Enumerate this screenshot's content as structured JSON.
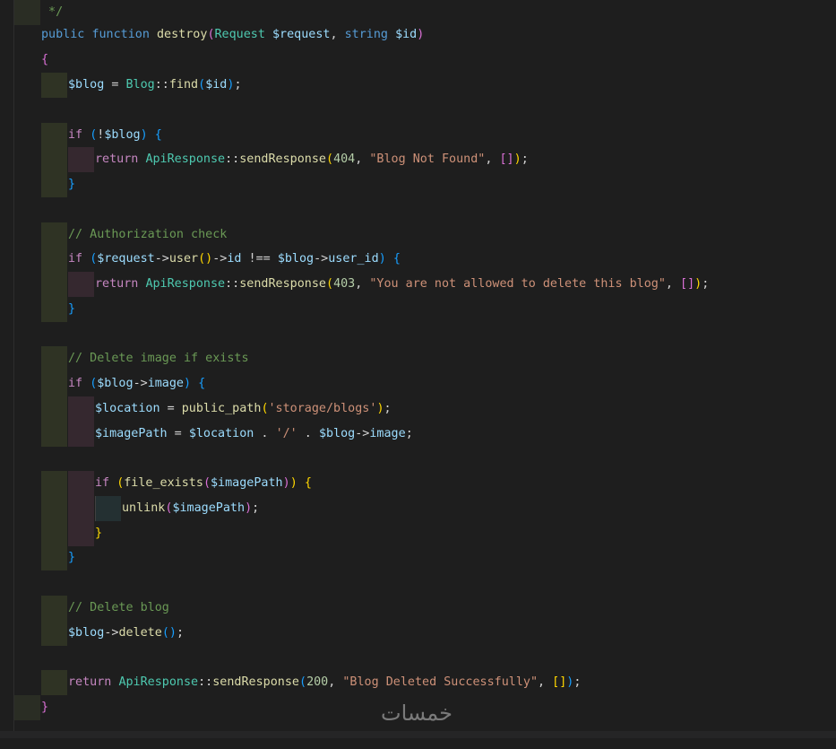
{
  "code": {
    "lines": {
      "l0": {
        "comment_end": " */"
      },
      "l1": {
        "kw_public": "public",
        "kw_function": "function",
        "fn_name": "destroy",
        "paren_open": "(",
        "cls_request": "Request",
        "var_request": "$request",
        "comma": ",",
        "kw_string": "string",
        "var_id": "$id",
        "paren_close": ")"
      },
      "l2": {
        "brace_open": "{"
      },
      "l3": {
        "var_blog": "$blog",
        "eq": " = ",
        "cls_blog": "Blog",
        "scope": "::",
        "fn_find": "find",
        "paren_open": "(",
        "var_id": "$id",
        "paren_close": ")",
        "semi": ";"
      },
      "l5": {
        "kw_if": "if",
        "paren_open": "(",
        "not": "!",
        "var_blog": "$blog",
        "paren_close": ")",
        "brace_open": "{"
      },
      "l6": {
        "kw_return": "return",
        "cls_api": "ApiResponse",
        "scope": "::",
        "fn_send": "sendResponse",
        "paren_open": "(",
        "num": "404",
        "comma1": ", ",
        "str": "\"Blog Not Found\"",
        "comma2": ", ",
        "arr": "[]",
        "paren_close": ")",
        "semi": ";"
      },
      "l7": {
        "brace_close": "}"
      },
      "l9": {
        "comment": "// Authorization check"
      },
      "l10": {
        "kw_if": "if",
        "paren_open": "(",
        "var_request": "$request",
        "arrow1": "->",
        "fn_user": "user",
        "call": "()",
        "arrow2": "->",
        "prop_id": "id",
        "neq": " !== ",
        "var_blog": "$blog",
        "arrow3": "->",
        "prop_user_id": "user_id",
        "paren_close": ")",
        "brace_open": "{"
      },
      "l11": {
        "kw_return": "return",
        "cls_api": "ApiResponse",
        "scope": "::",
        "fn_send": "sendResponse",
        "paren_open": "(",
        "num": "403",
        "comma1": ", ",
        "str": "\"You are not allowed to delete this blog\"",
        "comma2": ", ",
        "arr": "[]",
        "paren_close": ")",
        "semi": ";"
      },
      "l12": {
        "brace_close": "}"
      },
      "l14": {
        "comment": "// Delete image if exists"
      },
      "l15": {
        "kw_if": "if",
        "paren_open": "(",
        "var_blog": "$blog",
        "arrow": "->",
        "prop_image": "image",
        "paren_close": ")",
        "brace_open": "{"
      },
      "l16": {
        "var_location": "$location",
        "eq": " = ",
        "fn_public_path": "public_path",
        "paren_open": "(",
        "str": "'storage/blogs'",
        "paren_close": ")",
        "semi": ";"
      },
      "l17": {
        "var_imagePath": "$imagePath",
        "eq": " = ",
        "var_location": "$location",
        "dot1": " . ",
        "str": "'/'",
        "dot2": " . ",
        "var_blog": "$blog",
        "arrow": "->",
        "prop_image": "image",
        "semi": ";"
      },
      "l19": {
        "kw_if": "if",
        "paren_open": "(",
        "fn_file_exists": "file_exists",
        "paren2_open": "(",
        "var_imagePath": "$imagePath",
        "paren2_close": ")",
        "paren_close": ")",
        "brace_open": "{"
      },
      "l20": {
        "fn_unlink": "unlink",
        "paren_open": "(",
        "var_imagePath": "$imagePath",
        "paren_close": ")",
        "semi": ";"
      },
      "l21": {
        "brace_close": "}"
      },
      "l22": {
        "brace_close": "}"
      },
      "l24": {
        "comment": "// Delete blog"
      },
      "l25": {
        "var_blog": "$blog",
        "arrow": "->",
        "fn_delete": "delete",
        "call": "()",
        "semi": ";"
      },
      "l27": {
        "kw_return": "return",
        "cls_api": "ApiResponse",
        "scope": "::",
        "fn_send": "sendResponse",
        "paren_open": "(",
        "num": "200",
        "comma1": ", ",
        "str": "\"Blog Deleted Successfully\"",
        "comma2": ", ",
        "arr": "[]",
        "paren_close": ")",
        "semi": ";"
      },
      "l28": {
        "brace_close": "}"
      }
    }
  },
  "watermark": {
    "text": "خمسات"
  },
  "colors": {
    "background": "#1e1e1e",
    "keyword": "#569cd6",
    "control_keyword": "#c586c0",
    "function": "#dcdcaa",
    "class": "#4ec9b0",
    "variable": "#9cdcfe",
    "string": "#ce9178",
    "number": "#b5cea8",
    "comment": "#6a9955"
  }
}
